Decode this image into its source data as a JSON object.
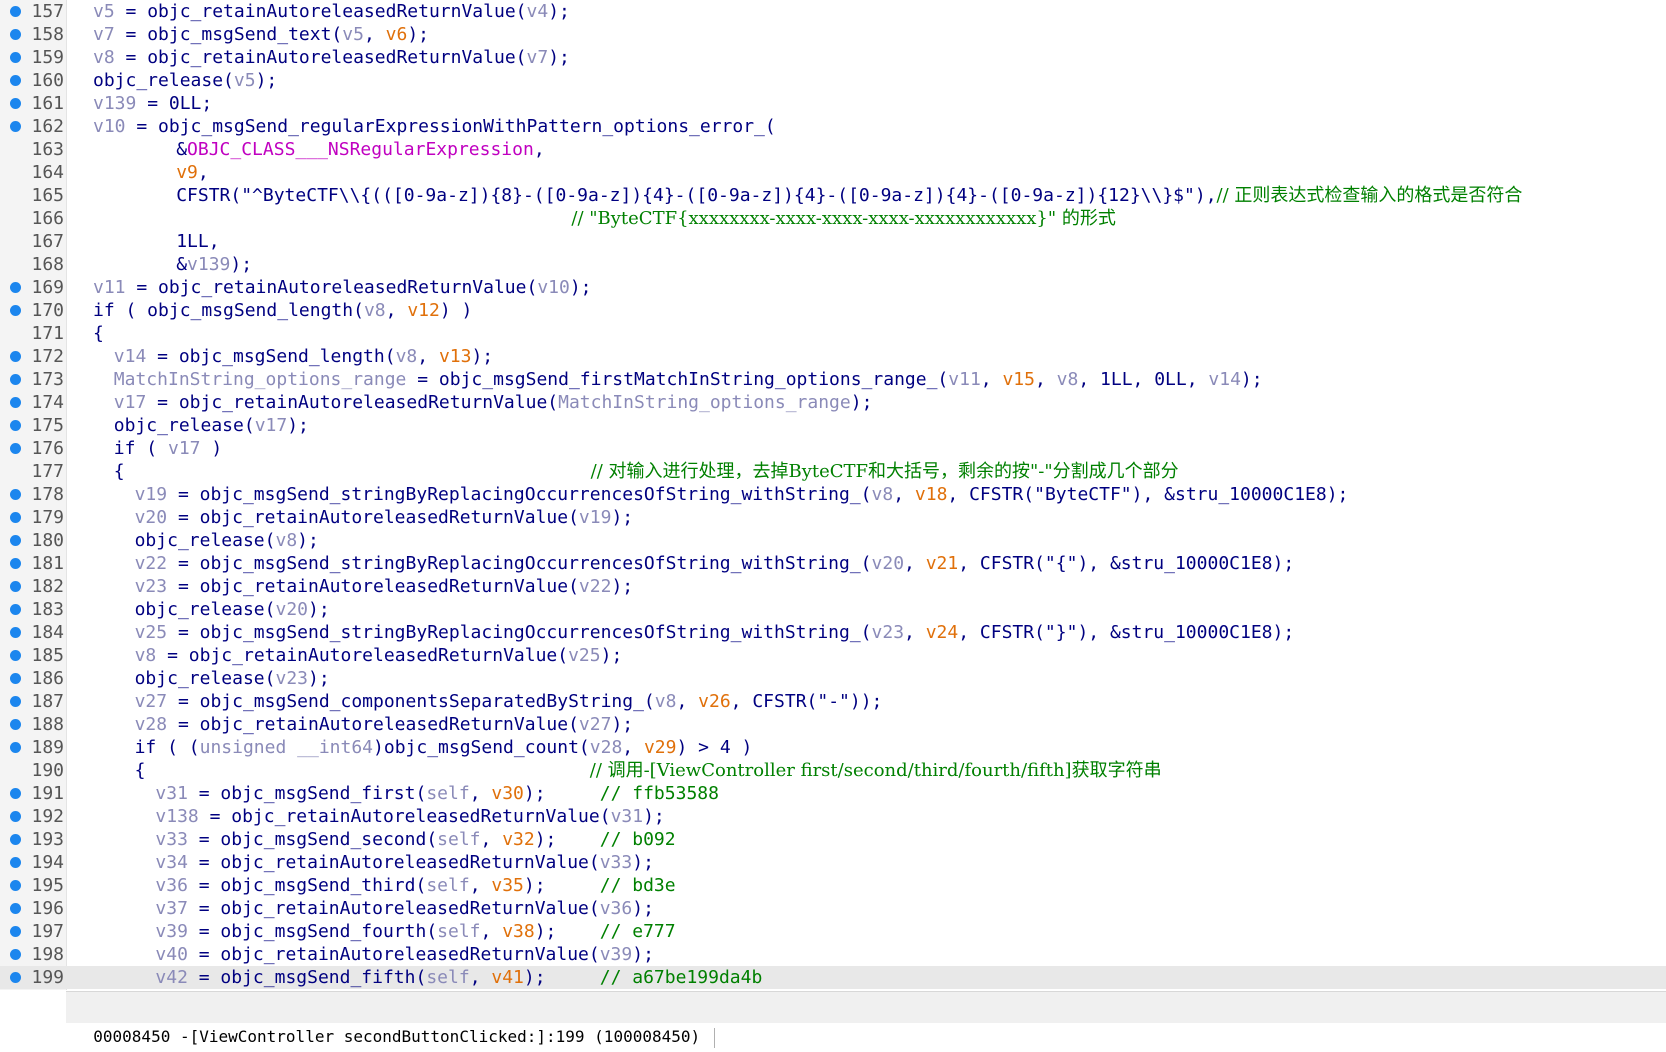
{
  "editor": {
    "lines": [
      {
        "num": "157",
        "bp": true,
        "current": false,
        "indent": 0,
        "tokens": [
          [
            "v",
            "v5"
          ],
          [
            "n",
            " = objc_retainAutoreleasedReturnValue("
          ],
          [
            "v",
            "v4"
          ],
          [
            "n",
            ");"
          ]
        ]
      },
      {
        "num": "158",
        "bp": true,
        "current": false,
        "indent": 0,
        "tokens": [
          [
            "v",
            "v7"
          ],
          [
            "n",
            " = objc_msgSend_text("
          ],
          [
            "v",
            "v5"
          ],
          [
            "n",
            ", "
          ],
          [
            "o",
            "v6"
          ],
          [
            "n",
            ");"
          ]
        ]
      },
      {
        "num": "159",
        "bp": true,
        "current": false,
        "indent": 0,
        "tokens": [
          [
            "v",
            "v8"
          ],
          [
            "n",
            " = objc_retainAutoreleasedReturnValue("
          ],
          [
            "v",
            "v7"
          ],
          [
            "n",
            ");"
          ]
        ]
      },
      {
        "num": "160",
        "bp": true,
        "current": false,
        "indent": 0,
        "tokens": [
          [
            "n",
            "objc_release("
          ],
          [
            "v",
            "v5"
          ],
          [
            "n",
            ");"
          ]
        ]
      },
      {
        "num": "161",
        "bp": true,
        "current": false,
        "indent": 0,
        "tokens": [
          [
            "v",
            "v139"
          ],
          [
            "n",
            " = 0LL;"
          ]
        ]
      },
      {
        "num": "162",
        "bp": true,
        "current": false,
        "indent": 0,
        "tokens": [
          [
            "v",
            "v10"
          ],
          [
            "n",
            " = objc_msgSend_regularExpressionWithPattern_options_error_("
          ]
        ]
      },
      {
        "num": "163",
        "bp": false,
        "current": false,
        "indent": 8,
        "tokens": [
          [
            "n",
            "&"
          ],
          [
            "p",
            "OBJC_CLASS___NSRegularExpression"
          ],
          [
            "n",
            ","
          ]
        ]
      },
      {
        "num": "164",
        "bp": false,
        "current": false,
        "indent": 8,
        "tokens": [
          [
            "o",
            "v9"
          ],
          [
            "n",
            ","
          ]
        ]
      },
      {
        "num": "165",
        "bp": false,
        "current": false,
        "indent": 8,
        "tokens": [
          [
            "n",
            "CFSTR(\"^ByteCTF\\\\{(([0-9a-z]){8}-([0-9a-z]){4}-([0-9a-z]){4}-([0-9a-z]){4}-([0-9a-z]){12}\\\\}$\"),"
          ],
          [
            "g",
            "// 正则表达式检查输入的格式是否符合"
          ]
        ]
      },
      {
        "num": "166",
        "bp": false,
        "current": false,
        "indent": 46,
        "tokens": [
          [
            "g",
            "// \"ByteCTF{xxxxxxxx-xxxx-xxxx-xxxx-xxxxxxxxxxxx}\" 的形式"
          ]
        ]
      },
      {
        "num": "167",
        "bp": false,
        "current": false,
        "indent": 8,
        "tokens": [
          [
            "n",
            "1LL,"
          ]
        ]
      },
      {
        "num": "168",
        "bp": false,
        "current": false,
        "indent": 8,
        "tokens": [
          [
            "n",
            "&"
          ],
          [
            "v",
            "v139"
          ],
          [
            "n",
            ");"
          ]
        ]
      },
      {
        "num": "169",
        "bp": true,
        "current": false,
        "indent": 0,
        "tokens": [
          [
            "v",
            "v11"
          ],
          [
            "n",
            " = objc_retainAutoreleasedReturnValue("
          ],
          [
            "v",
            "v10"
          ],
          [
            "n",
            ");"
          ]
        ]
      },
      {
        "num": "170",
        "bp": true,
        "current": false,
        "indent": 0,
        "tokens": [
          [
            "n",
            "if ( objc_msgSend_length("
          ],
          [
            "v",
            "v8"
          ],
          [
            "n",
            ", "
          ],
          [
            "o",
            "v12"
          ],
          [
            "n",
            ") )"
          ]
        ]
      },
      {
        "num": "171",
        "bp": false,
        "current": false,
        "indent": 0,
        "tokens": [
          [
            "n",
            "{"
          ]
        ]
      },
      {
        "num": "172",
        "bp": true,
        "current": false,
        "indent": 2,
        "tokens": [
          [
            "v",
            "v14"
          ],
          [
            "n",
            " = objc_msgSend_length("
          ],
          [
            "v",
            "v8"
          ],
          [
            "n",
            ", "
          ],
          [
            "o",
            "v13"
          ],
          [
            "n",
            ");"
          ]
        ]
      },
      {
        "num": "173",
        "bp": true,
        "current": false,
        "indent": 2,
        "tokens": [
          [
            "v",
            "MatchInString_options_range"
          ],
          [
            "n",
            " = objc_msgSend_firstMatchInString_options_range_("
          ],
          [
            "v",
            "v11"
          ],
          [
            "n",
            ", "
          ],
          [
            "o",
            "v15"
          ],
          [
            "n",
            ", "
          ],
          [
            "v",
            "v8"
          ],
          [
            "n",
            ", 1LL, 0LL, "
          ],
          [
            "v",
            "v14"
          ],
          [
            "n",
            ");"
          ]
        ]
      },
      {
        "num": "174",
        "bp": true,
        "current": false,
        "indent": 2,
        "tokens": [
          [
            "v",
            "v17"
          ],
          [
            "n",
            " = objc_retainAutoreleasedReturnValue("
          ],
          [
            "v",
            "MatchInString_options_range"
          ],
          [
            "n",
            ");"
          ]
        ]
      },
      {
        "num": "175",
        "bp": true,
        "current": false,
        "indent": 2,
        "tokens": [
          [
            "n",
            "objc_release("
          ],
          [
            "v",
            "v17"
          ],
          [
            "n",
            ");"
          ]
        ]
      },
      {
        "num": "176",
        "bp": true,
        "current": false,
        "indent": 2,
        "tokens": [
          [
            "n",
            "if ( "
          ],
          [
            "v",
            "v17"
          ],
          [
            "n",
            " )"
          ]
        ]
      },
      {
        "num": "177",
        "bp": false,
        "current": false,
        "indent": 2,
        "tokens": [
          [
            "n",
            "{                                           "
          ],
          [
            "g",
            "// 对输入进行处理，去掉ByteCTF和大括号，剩余的按\"-\"分割成几个部分"
          ]
        ]
      },
      {
        "num": "178",
        "bp": true,
        "current": false,
        "indent": 4,
        "tokens": [
          [
            "v",
            "v19"
          ],
          [
            "n",
            " = objc_msgSend_stringByReplacingOccurrencesOfString_withString_("
          ],
          [
            "v",
            "v8"
          ],
          [
            "n",
            ", "
          ],
          [
            "o",
            "v18"
          ],
          [
            "n",
            ", CFSTR(\"ByteCTF\"), &stru_10000C1E8);"
          ]
        ]
      },
      {
        "num": "179",
        "bp": true,
        "current": false,
        "indent": 4,
        "tokens": [
          [
            "v",
            "v20"
          ],
          [
            "n",
            " = objc_retainAutoreleasedReturnValue("
          ],
          [
            "v",
            "v19"
          ],
          [
            "n",
            ");"
          ]
        ]
      },
      {
        "num": "180",
        "bp": true,
        "current": false,
        "indent": 4,
        "tokens": [
          [
            "n",
            "objc_release("
          ],
          [
            "v",
            "v8"
          ],
          [
            "n",
            ");"
          ]
        ]
      },
      {
        "num": "181",
        "bp": true,
        "current": false,
        "indent": 4,
        "tokens": [
          [
            "v",
            "v22"
          ],
          [
            "n",
            " = objc_msgSend_stringByReplacingOccurrencesOfString_withString_("
          ],
          [
            "v",
            "v20"
          ],
          [
            "n",
            ", "
          ],
          [
            "o",
            "v21"
          ],
          [
            "n",
            ", CFSTR(\"{\"), &stru_10000C1E8);"
          ]
        ]
      },
      {
        "num": "182",
        "bp": true,
        "current": false,
        "indent": 4,
        "tokens": [
          [
            "v",
            "v23"
          ],
          [
            "n",
            " = objc_retainAutoreleasedReturnValue("
          ],
          [
            "v",
            "v22"
          ],
          [
            "n",
            ");"
          ]
        ]
      },
      {
        "num": "183",
        "bp": true,
        "current": false,
        "indent": 4,
        "tokens": [
          [
            "n",
            "objc_release("
          ],
          [
            "v",
            "v20"
          ],
          [
            "n",
            ");"
          ]
        ]
      },
      {
        "num": "184",
        "bp": true,
        "current": false,
        "indent": 4,
        "tokens": [
          [
            "v",
            "v25"
          ],
          [
            "n",
            " = objc_msgSend_stringByReplacingOccurrencesOfString_withString_("
          ],
          [
            "v",
            "v23"
          ],
          [
            "n",
            ", "
          ],
          [
            "o",
            "v24"
          ],
          [
            "n",
            ", CFSTR(\"}\"), &stru_10000C1E8);"
          ]
        ]
      },
      {
        "num": "185",
        "bp": true,
        "current": false,
        "indent": 4,
        "tokens": [
          [
            "v",
            "v8"
          ],
          [
            "n",
            " = objc_retainAutoreleasedReturnValue("
          ],
          [
            "v",
            "v25"
          ],
          [
            "n",
            ");"
          ]
        ]
      },
      {
        "num": "186",
        "bp": true,
        "current": false,
        "indent": 4,
        "tokens": [
          [
            "n",
            "objc_release("
          ],
          [
            "v",
            "v23"
          ],
          [
            "n",
            ");"
          ]
        ]
      },
      {
        "num": "187",
        "bp": true,
        "current": false,
        "indent": 4,
        "tokens": [
          [
            "v",
            "v27"
          ],
          [
            "n",
            " = objc_msgSend_componentsSeparatedByString_("
          ],
          [
            "v",
            "v8"
          ],
          [
            "n",
            ", "
          ],
          [
            "o",
            "v26"
          ],
          [
            "n",
            ", CFSTR(\"-\"));"
          ]
        ]
      },
      {
        "num": "188",
        "bp": true,
        "current": false,
        "indent": 4,
        "tokens": [
          [
            "v",
            "v28"
          ],
          [
            "n",
            " = objc_retainAutoreleasedReturnValue("
          ],
          [
            "v",
            "v27"
          ],
          [
            "n",
            ");"
          ]
        ]
      },
      {
        "num": "189",
        "bp": true,
        "current": false,
        "indent": 4,
        "tokens": [
          [
            "n",
            "if ( ("
          ],
          [
            "v",
            "unsigned __int64"
          ],
          [
            "n",
            ")objc_msgSend_count("
          ],
          [
            "v",
            "v28"
          ],
          [
            "n",
            ", "
          ],
          [
            "o",
            "v29"
          ],
          [
            "n",
            ") > 4 )"
          ]
        ]
      },
      {
        "num": "190",
        "bp": false,
        "current": false,
        "indent": 4,
        "tokens": [
          [
            "n",
            "{                                         "
          ],
          [
            "g",
            "// 调用-[ViewController first/second/third/fourth/fifth]获取字符串"
          ]
        ]
      },
      {
        "num": "191",
        "bp": true,
        "current": false,
        "indent": 6,
        "tokens": [
          [
            "v",
            "v31"
          ],
          [
            "n",
            " = objc_msgSend_first("
          ],
          [
            "v",
            "self"
          ],
          [
            "n",
            ", "
          ],
          [
            "o",
            "v30"
          ],
          [
            "n",
            ");     "
          ],
          [
            "g",
            "// ffb53588"
          ]
        ]
      },
      {
        "num": "192",
        "bp": true,
        "current": false,
        "indent": 6,
        "tokens": [
          [
            "v",
            "v138"
          ],
          [
            "n",
            " = objc_retainAutoreleasedReturnValue("
          ],
          [
            "v",
            "v31"
          ],
          [
            "n",
            ");"
          ]
        ]
      },
      {
        "num": "193",
        "bp": true,
        "current": false,
        "indent": 6,
        "tokens": [
          [
            "v",
            "v33"
          ],
          [
            "n",
            " = objc_msgSend_second("
          ],
          [
            "v",
            "self"
          ],
          [
            "n",
            ", "
          ],
          [
            "o",
            "v32"
          ],
          [
            "n",
            ");    "
          ],
          [
            "g",
            "// b092"
          ]
        ]
      },
      {
        "num": "194",
        "bp": true,
        "current": false,
        "indent": 6,
        "tokens": [
          [
            "v",
            "v34"
          ],
          [
            "n",
            " = objc_retainAutoreleasedReturnValue("
          ],
          [
            "v",
            "v33"
          ],
          [
            "n",
            ");"
          ]
        ]
      },
      {
        "num": "195",
        "bp": true,
        "current": false,
        "indent": 6,
        "tokens": [
          [
            "v",
            "v36"
          ],
          [
            "n",
            " = objc_msgSend_third("
          ],
          [
            "v",
            "self"
          ],
          [
            "n",
            ", "
          ],
          [
            "o",
            "v35"
          ],
          [
            "n",
            ");     "
          ],
          [
            "g",
            "// bd3e"
          ]
        ]
      },
      {
        "num": "196",
        "bp": true,
        "current": false,
        "indent": 6,
        "tokens": [
          [
            "v",
            "v37"
          ],
          [
            "n",
            " = objc_retainAutoreleasedReturnValue("
          ],
          [
            "v",
            "v36"
          ],
          [
            "n",
            ");"
          ]
        ]
      },
      {
        "num": "197",
        "bp": true,
        "current": false,
        "indent": 6,
        "tokens": [
          [
            "v",
            "v39"
          ],
          [
            "n",
            " = objc_msgSend_fourth("
          ],
          [
            "v",
            "self"
          ],
          [
            "n",
            ", "
          ],
          [
            "o",
            "v38"
          ],
          [
            "n",
            ");    "
          ],
          [
            "g",
            "// e777"
          ]
        ]
      },
      {
        "num": "198",
        "bp": true,
        "current": false,
        "indent": 6,
        "tokens": [
          [
            "v",
            "v40"
          ],
          [
            "n",
            " = objc_retainAutoreleasedReturnValue("
          ],
          [
            "v",
            "v39"
          ],
          [
            "n",
            ");"
          ]
        ]
      },
      {
        "num": "199",
        "bp": true,
        "current": true,
        "indent": 6,
        "tokens": [
          [
            "v",
            "v42"
          ],
          [
            "n",
            " = objc_msgSend_fifth("
          ],
          [
            "v",
            "self"
          ],
          [
            "n",
            ", "
          ],
          [
            "o",
            "v41"
          ],
          [
            "n",
            ");     "
          ],
          [
            "g",
            "// a67be199da4b"
          ]
        ]
      }
    ]
  },
  "statusbar": {
    "text": "00008450 -[ViewController secondButtonClicked:]:199 (100008450)"
  },
  "colors": {
    "normal": "#000080",
    "variable": "#8a8ab8",
    "arg": "#e0700a",
    "comment": "#008000",
    "class": "#c000c0",
    "breakpoint": "#1c86ee"
  }
}
